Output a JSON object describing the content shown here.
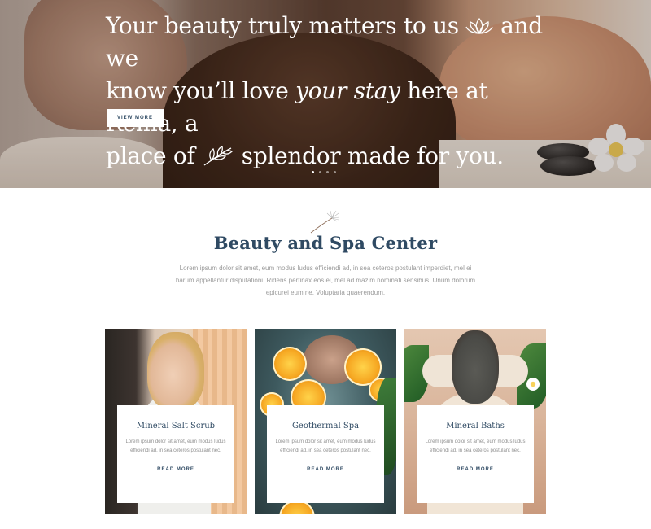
{
  "hero": {
    "line1_a": "Your beauty truly matters to us",
    "line1_b": "and we",
    "line2_a": "know you’ll love",
    "line2_em": "your stay",
    "line2_b": "here at Reina, a",
    "line3_a": "place of",
    "line3_b": "splendor made for you.",
    "lotus_icon": "lotus-icon",
    "leaf_icon": "leaf-branch-icon",
    "button_label": "VIEW MORE",
    "slides": 4,
    "active_slide": 1
  },
  "section": {
    "icon": "dandelion-icon",
    "title": "Beauty and Spa Center",
    "description": "Lorem ipsum dolor sit amet, eum modus ludus efficiendi ad, in sea ceteros postulant imperdiet, mel ei harum appellantur disputationi. Ridens pertinax eos ei, mel ad mazim nominati sensibus. Unum dolorum epicurei eum ne. Voluptaria quaerendum."
  },
  "cards": [
    {
      "title": "Mineral Salt Scrub",
      "text": "Lorem ipsum dolor sit amet, eum modus ludus efficiendi ad, in sea ceteros postulant nec.",
      "link": "READ MORE"
    },
    {
      "title": "Geothermal Spa",
      "text": "Lorem ipsum dolor sit amet, eum modus ludus efficiendi ad, in sea ceteros postulant nec.",
      "link": "READ MORE"
    },
    {
      "title": "Mineral Baths",
      "text": "Lorem ipsum dolor sit amet, eum modus ludus efficiendi ad, in sea ceteros postulant nec.",
      "link": "READ MORE"
    }
  ],
  "colors": {
    "accent": "#2f4a63",
    "muted_text": "#9a9a9a"
  }
}
